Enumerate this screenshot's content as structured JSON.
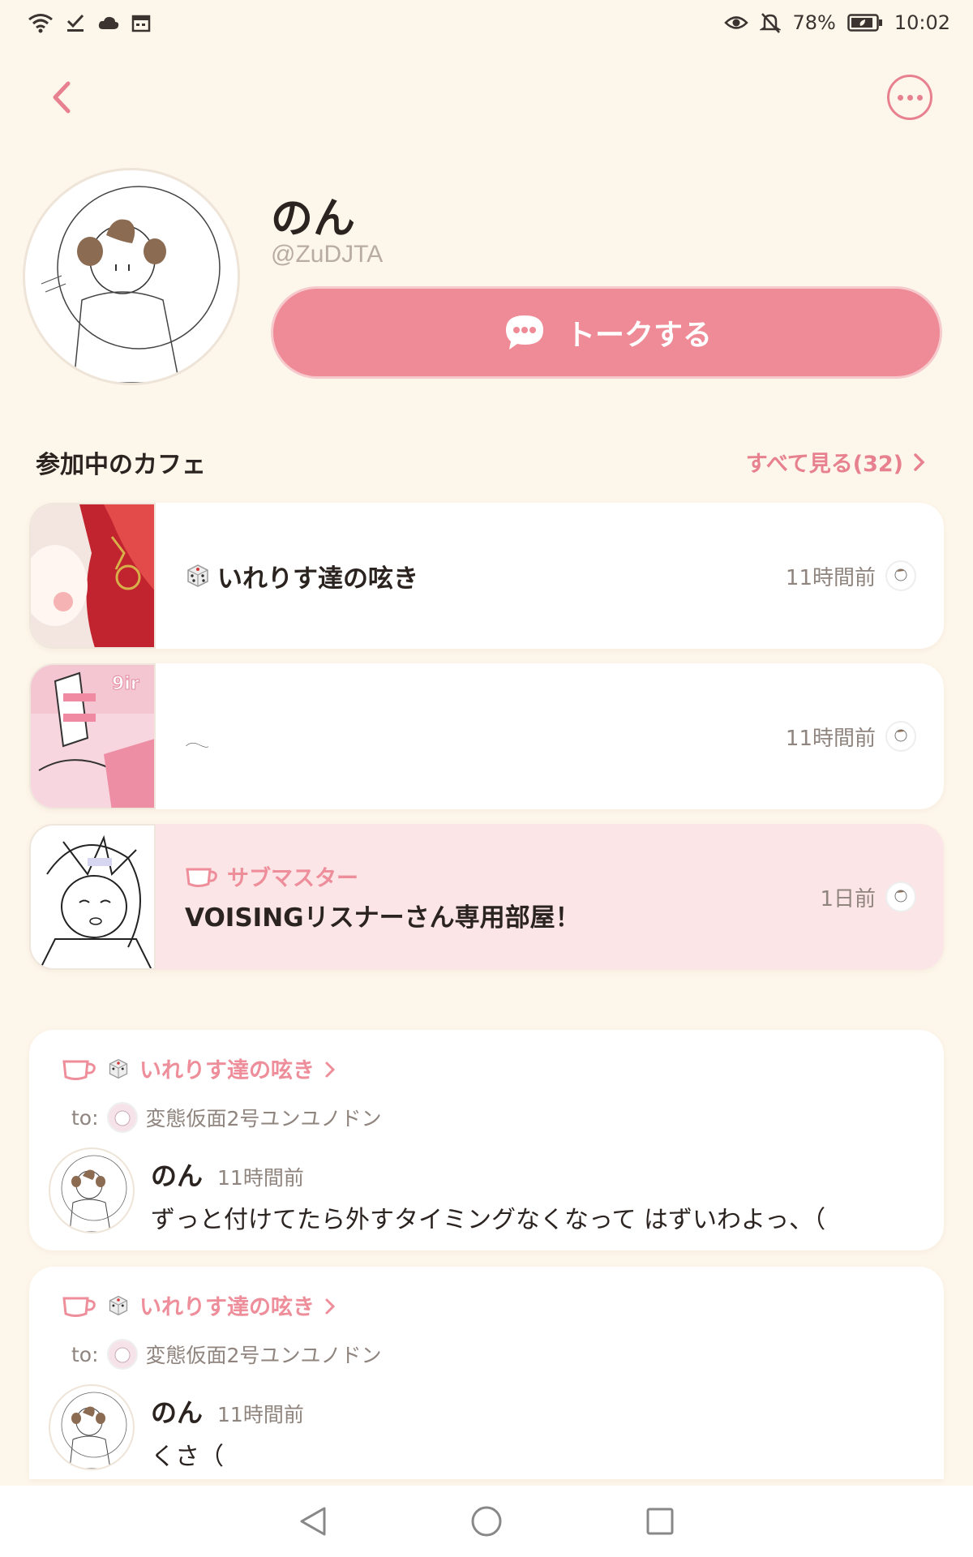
{
  "status_bar": {
    "battery": "78%",
    "time": "10:02",
    "left_icons": [
      "wifi-icon",
      "download-check-icon",
      "cloud-icon",
      "calendar-icon"
    ],
    "right_icons": [
      "eye-icon",
      "bell-off-icon",
      "battery-icon"
    ]
  },
  "header": {
    "back_icon": "chevron-left-icon",
    "more_icon": "more-horizontal-icon"
  },
  "profile": {
    "name": "のん",
    "handle": "@ZuDJTA",
    "talk_button": "トークする"
  },
  "cafes_section": {
    "title": "参加中のカフェ",
    "see_all": "すべて見る(32)",
    "items": [
      {
        "name": "いれりす達の呟き",
        "prefix_icon": "dice-icon",
        "role": "",
        "time": "11時間前"
      },
      {
        "name": "𓂃",
        "prefix_icon": "",
        "role": "",
        "time": "11時間前"
      },
      {
        "name": "VOISINGリスナーさん専用部屋！",
        "prefix_icon": "",
        "role": "サブマスター",
        "time": "1日前"
      }
    ]
  },
  "posts": [
    {
      "cafe": "いれりす達の呟き",
      "to_label": "to:",
      "to_user": "変態仮面2号ユンユノドン",
      "author": "のん",
      "time": "11時間前",
      "text": "ずっと付けてたら外すタイミングなくなって はずいわよっ、（"
    },
    {
      "cafe": "いれりす達の呟き",
      "to_label": "to:",
      "to_user": "変態仮面2号ユンユノドン",
      "author": "のん",
      "time": "11時間前",
      "text": "くさ（"
    }
  ],
  "colors": {
    "background": "#fdf6ea",
    "accent": "#ef8b96",
    "accent_text": "#e8818f",
    "highlight_card": "#fbe5e7"
  }
}
